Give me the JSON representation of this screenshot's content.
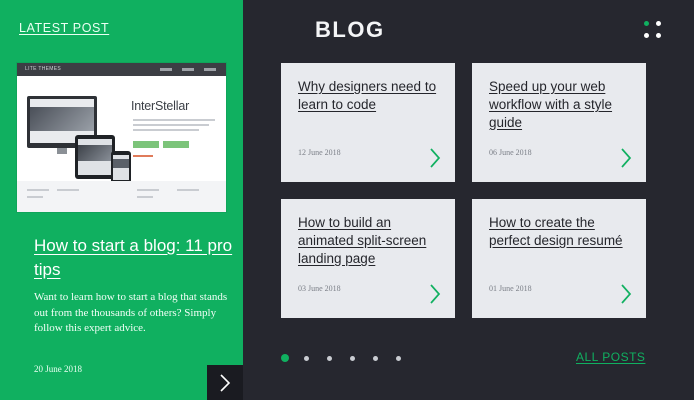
{
  "latest": {
    "label": "LATEST POST",
    "thumbnail": {
      "brand": "LITE THEMES",
      "title": "InterStellar"
    },
    "title": "How to start a blog: 11 pro tips",
    "excerpt": "Want to learn how to start a blog that stands out from the thousands of others? Simply follow this expert advice.",
    "date": "20 June 2018",
    "next_icon": "chevron-right-icon"
  },
  "blog": {
    "title": "BLOG",
    "menu_icon": "grid-dots-icon",
    "cards": [
      {
        "title": "Why designers need to learn to code",
        "date": "12 June 2018",
        "icon": "chevron-right-icon"
      },
      {
        "title": "Speed up your web workflow with a style guide",
        "date": "06 June 2018",
        "icon": "chevron-right-icon"
      },
      {
        "title": "How to build an animated split-screen landing page",
        "date": "03 June 2018",
        "icon": "chevron-right-icon"
      },
      {
        "title": "How to create the perfect design resumé",
        "date": "01 June 2018",
        "icon": "chevron-right-icon"
      }
    ],
    "pagination": {
      "pages": 6,
      "current": 1
    },
    "all_posts_label": "ALL POSTS"
  },
  "colors": {
    "accent_green": "#10b060",
    "dark_panel": "#26272f",
    "card_bg": "#e8eaee",
    "arrow_green": "#10b060"
  }
}
